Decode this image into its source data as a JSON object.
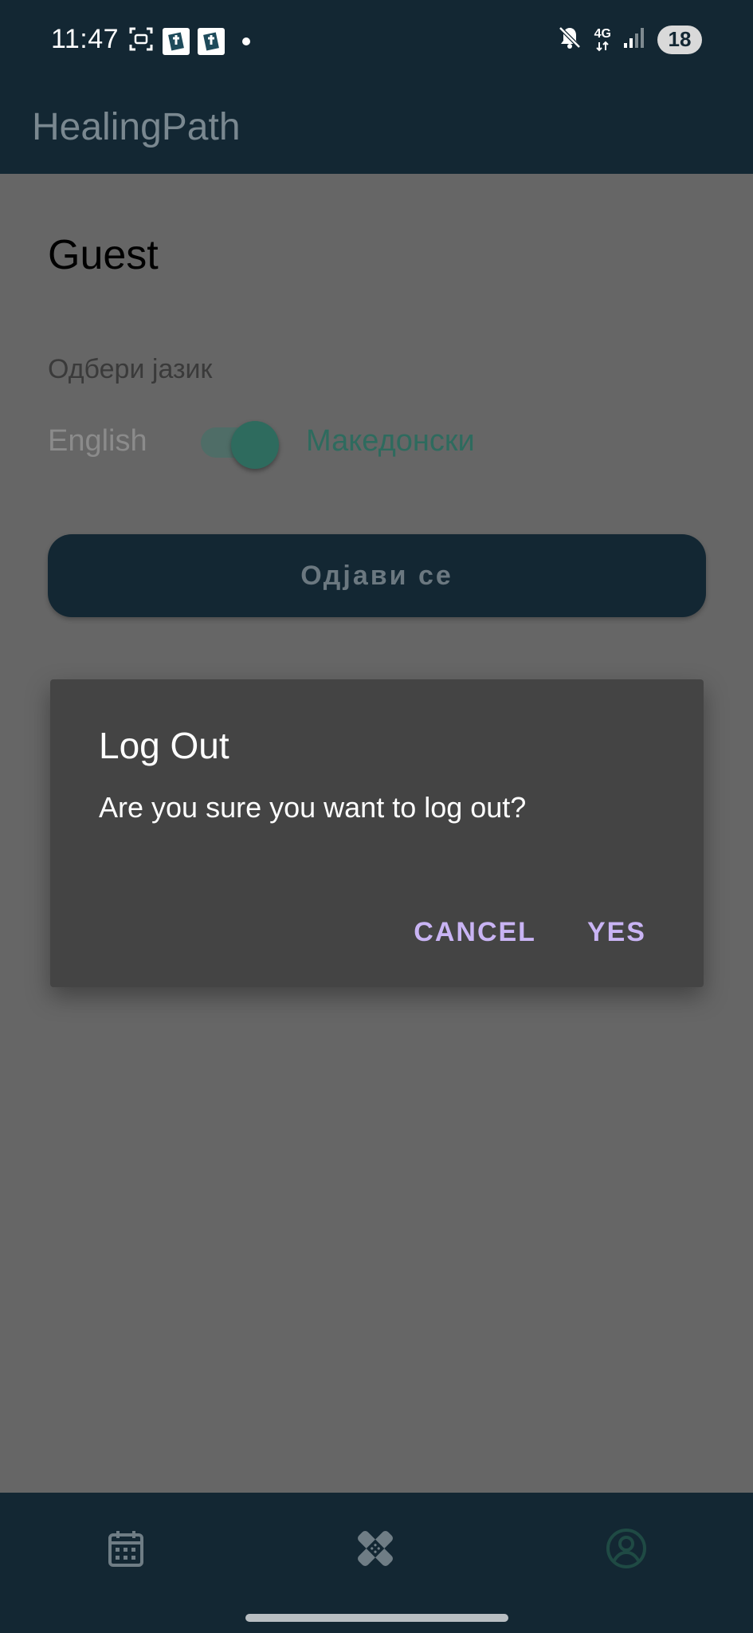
{
  "status_bar": {
    "time": "11:47",
    "network": "4G",
    "battery": "18",
    "icons": [
      "screenshot-icon",
      "app-badge-icon",
      "app-badge-icon",
      "notification-dot-icon",
      "mute-icon",
      "network-4g-icon",
      "signal-icon",
      "battery-icon"
    ]
  },
  "app_bar": {
    "title": "HealingPath"
  },
  "profile": {
    "user_name": "Guest",
    "language_label": "Одбери јазик",
    "english_label": "English",
    "macedonian_label": "Македонски",
    "toggle_selected": "Македонски",
    "logout_button": "Одјави се"
  },
  "dialog": {
    "title": "Log Out",
    "message": "Are you sure you want to log out?",
    "cancel": "CANCEL",
    "confirm": "YES"
  },
  "bottom_nav": {
    "items": [
      "calendar-icon",
      "bandage-icon",
      "profile-icon"
    ],
    "active": "profile-icon"
  },
  "colors": {
    "bar_background": "#132733",
    "scrim": "#666666",
    "accent_green": "#2e6b5e",
    "dialog_background": "#444444",
    "dialog_button": "#c9b4f4"
  }
}
